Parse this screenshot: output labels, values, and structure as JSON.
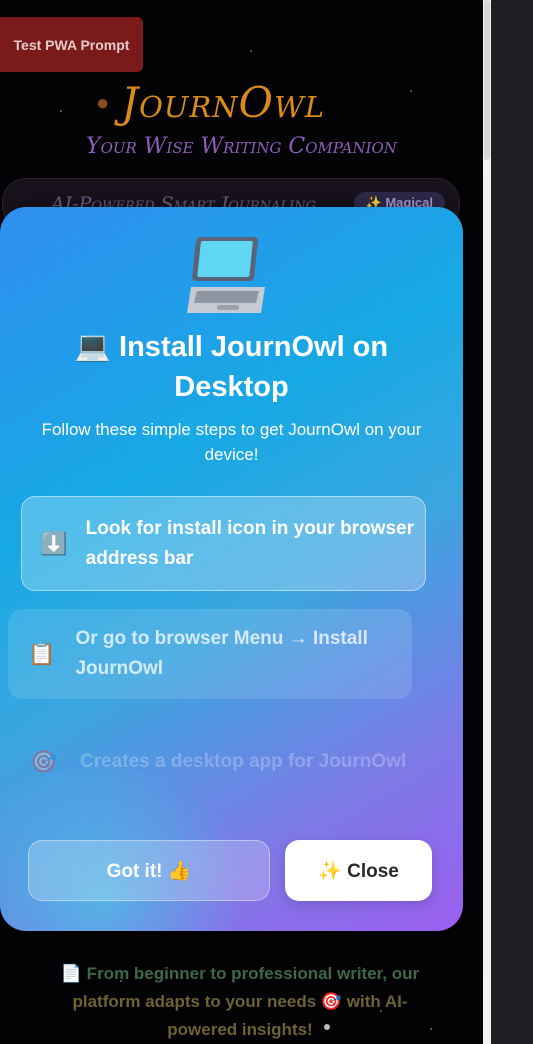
{
  "pwa_button": {
    "label": "Test PWA Prompt"
  },
  "brand": {
    "name": "JournOwl",
    "tagline": "Your Wise Writing Companion"
  },
  "feature_bar": {
    "text": "AI-Powered Smart Journaling",
    "badge": "✨ Magical"
  },
  "modal": {
    "title": "💻 Install JournOwl on Desktop",
    "subtitle": "Follow these simple steps to get JournOwl on your device!",
    "steps": [
      {
        "icon": "⬇️",
        "icon_name": "download-arrow-icon",
        "text": "Look for install icon in your browser address bar"
      },
      {
        "icon": "📋",
        "icon_name": "clipboard-icon",
        "text": "Or go to browser Menu → Install JournOwl"
      },
      {
        "icon": "🎯",
        "icon_name": "target-icon",
        "text": "Creates a desktop app for JournOwl"
      }
    ],
    "got_it_label": "Got it! 👍",
    "close_label": "✨ Close"
  },
  "bottom_text": {
    "line1": "📄 From beginner to professional writer, our",
    "line2": "platform adapts to your needs 🎯 with AI-",
    "line3": "powered insights!"
  },
  "colors": {
    "accent_gradient_start": "#2f8ef0",
    "accent_gradient_end": "#9b5ef0",
    "brand_orange": "#d78a1e",
    "tagline_purple": "#8d5db8",
    "pwa_button_red": "#7a1a1a"
  }
}
